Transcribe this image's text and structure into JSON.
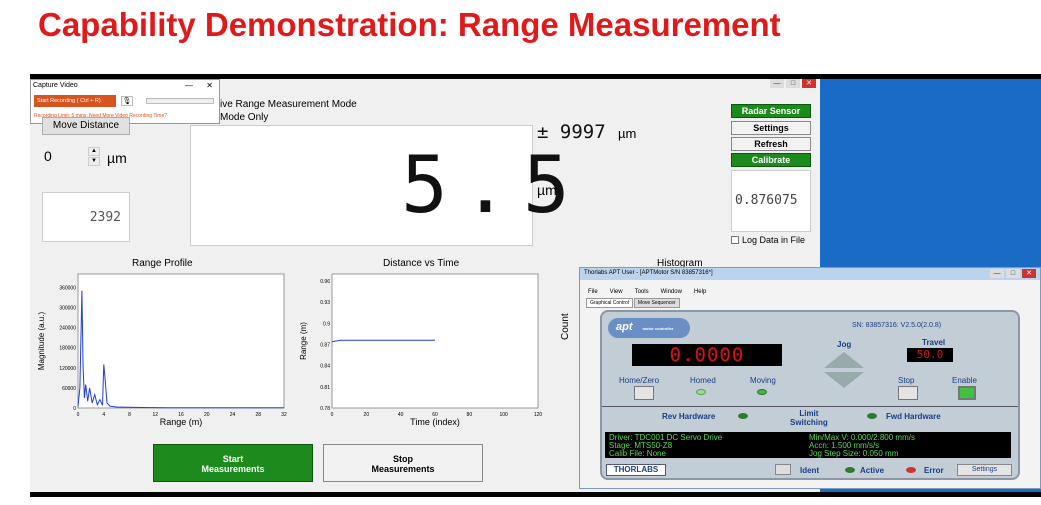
{
  "title": "Capability Demonstration: Range Measurement",
  "capture": {
    "title": "Capture Video",
    "record_btn": "Start Recording ( Ctrl + R)",
    "limit": "Recording Limit: 5 mins. Need More Video Recording Time?",
    "min": "—",
    "close": "✕"
  },
  "main": {
    "mode1": "ive Range Measurement Mode",
    "mode2": "Mode Only",
    "move_distance": "Move Distance",
    "distance_value": "0",
    "distance_unit": "µm",
    "small_display": "2392",
    "big_display": "5.5",
    "big_unit": "µm",
    "pm_value": "± 9997",
    "pm_unit": "µm",
    "radar_sensor": "Radar Sensor",
    "settings": "Settings",
    "refresh": "Refresh",
    "calibrate": "Calibrate",
    "side_display": "0.876075",
    "log_data": "Log Data in File",
    "range_profile": "Range Profile",
    "distance_vs_time": "Distance vs Time",
    "histogram": "Histogram",
    "count": "Count",
    "start_meas": "Start\nMeasurements",
    "stop_meas": "Stop\nMeasurements"
  },
  "chart_data": [
    {
      "type": "line",
      "title": "Range Profile",
      "xlabel": "Range (m)",
      "ylabel": "Magnitude (a.u.)",
      "xlim": [
        0,
        32
      ],
      "ylim": [
        0,
        400000
      ],
      "xticks": [
        "0",
        "4",
        "8",
        "12",
        "16",
        "20",
        "24",
        "28",
        "32"
      ],
      "yticks": [
        "0",
        "60000",
        "120000",
        "180000",
        "240000",
        "300000",
        "360000"
      ],
      "x": [
        0,
        0.3,
        0.6,
        0.8,
        1.0,
        1.2,
        1.5,
        1.8,
        2.2,
        2.6,
        3.0,
        3.4,
        3.8,
        4.0,
        4.2,
        4.5,
        5,
        6,
        8,
        10,
        14,
        20,
        26,
        32
      ],
      "values": [
        5000,
        60000,
        350000,
        120000,
        30000,
        70000,
        20000,
        60000,
        15000,
        40000,
        10000,
        25000,
        8000,
        130000,
        90000,
        15000,
        5000,
        3000,
        2000,
        1500,
        1000,
        800,
        600,
        500
      ]
    },
    {
      "type": "line",
      "title": "Distance vs Time",
      "xlabel": "Time (index)",
      "ylabel": "Range (m)",
      "xlim": [
        0,
        120
      ],
      "ylim": [
        0.78,
        0.97
      ],
      "xticks": [
        "0",
        "20",
        "40",
        "60",
        "80",
        "100",
        "120"
      ],
      "yticks": [
        "0.78",
        "0.81",
        "0.84",
        "0.87",
        "0.9",
        "0.93",
        "0.96"
      ],
      "x": [
        0,
        5,
        10,
        20,
        40,
        60
      ],
      "values": [
        0.874,
        0.876,
        0.876,
        0.876,
        0.876,
        0.876
      ]
    }
  ],
  "apt": {
    "window_title": "Thorlabs APT User - [APTMotor S/N 83857316*]",
    "menu": [
      "File",
      "View",
      "Tools",
      "Window",
      "Help"
    ],
    "tabs": [
      "Graphical Control",
      "Move Sequencer"
    ],
    "logo": "apt",
    "logo_sub": "motor controller",
    "serial": "SN: 83857316: V2.5.0(2.0.8)",
    "position": "0.0000",
    "jog": "Jog",
    "travel": "Travel",
    "travel_value": "50.0",
    "home_zero": "Home/Zero",
    "homed": "Homed",
    "moving": "Moving",
    "stop": "Stop",
    "enable": "Enable",
    "rev_hw": "Rev Hardware",
    "limit_sw": "Limit\nSwitching",
    "fwd_hw": "Fwd Hardware",
    "info_left": [
      "Driver: TDC001 DC Servo Drive",
      "Stage: MTS50-Z8",
      "Calib File: None"
    ],
    "info_right": [
      "Min/Max V: 0.000/2.800 mm/s",
      "Accn: 1.500 mm/s/s",
      "Jog Step Size: 0.050 mm"
    ],
    "brand": "THORLABS",
    "ident": "Ident",
    "active": "Active",
    "error": "Error",
    "settings": "Settings"
  },
  "colors": {
    "title": "#e01a1a",
    "green": "#1c8a1c",
    "led_red": "#e01010",
    "plot_line": "#1f3fd6"
  }
}
